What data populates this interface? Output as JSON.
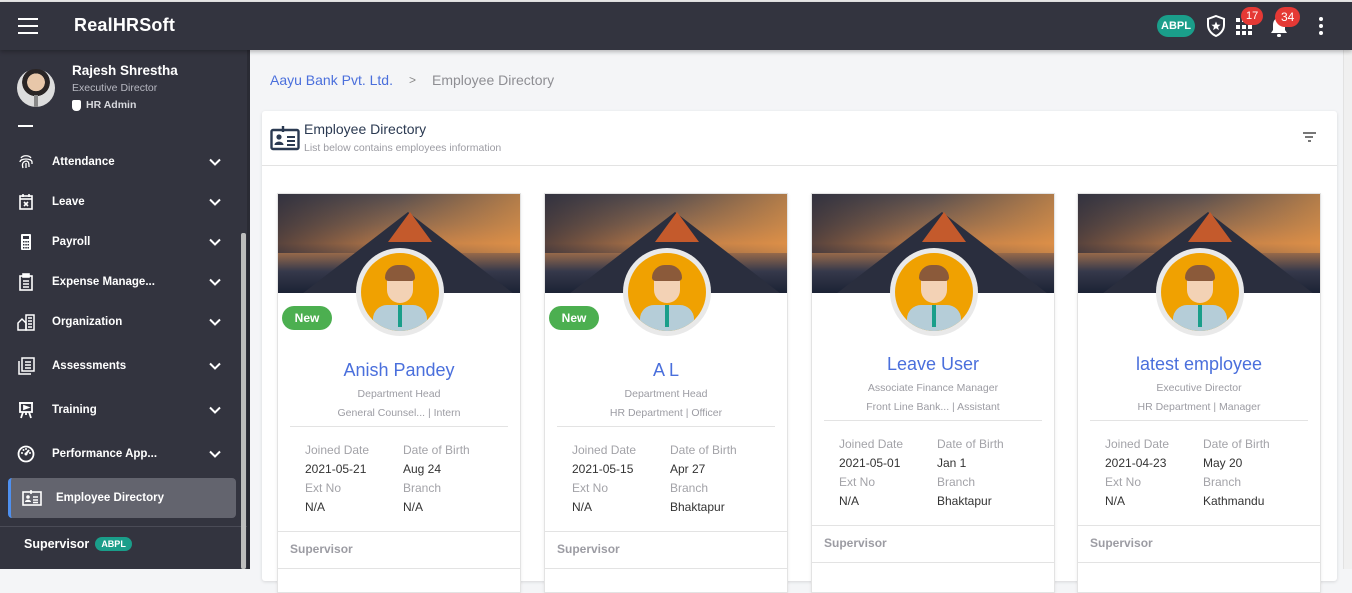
{
  "app": {
    "title": "RealHRSoft"
  },
  "topbar": {
    "company_badge": "ABPL",
    "apps_count": "17",
    "notifications_count": "34"
  },
  "profile": {
    "name": "Rajesh Shrestha",
    "designation": "Executive Director",
    "role": "HR Admin"
  },
  "sidebar": {
    "items": [
      {
        "label": "Attendance",
        "icon": "fingerprint-icon",
        "expandable": true
      },
      {
        "label": "Leave",
        "icon": "calendar-x-icon",
        "expandable": true
      },
      {
        "label": "Payroll",
        "icon": "calculator-icon",
        "expandable": true
      },
      {
        "label": "Expense Manage...",
        "icon": "clipboard-list-icon",
        "expandable": true
      },
      {
        "label": "Organization",
        "icon": "building-icon",
        "expandable": true
      },
      {
        "label": "Assessments",
        "icon": "documents-icon",
        "expandable": true
      },
      {
        "label": "Training",
        "icon": "presentation-icon",
        "expandable": true
      },
      {
        "label": "Performance App...",
        "icon": "speedometer-icon",
        "expandable": true
      },
      {
        "label": "Employee Directory",
        "icon": "id-card-icon",
        "expandable": false,
        "active": true
      }
    ],
    "supervisor_label": "Supervisor",
    "supervisor_badge": "ABPL"
  },
  "breadcrumb": {
    "parent": "Aayu Bank Pvt. Ltd.",
    "separator": ">",
    "current": "Employee Directory"
  },
  "panel": {
    "title": "Employee Directory",
    "subtitle": "List below contains employees information"
  },
  "labels": {
    "joined_date": "Joined Date",
    "date_of_birth": "Date of Birth",
    "ext_no": "Ext No",
    "branch": "Branch",
    "supervisor": "Supervisor",
    "new_badge": "New"
  },
  "employees": [
    {
      "name": "Anish Pandey",
      "designation": "Department Head",
      "department": "General Counsel... | Intern",
      "joined_date": "2021-05-21",
      "date_of_birth": "Aug 24",
      "ext_no": "N/A",
      "branch": "N/A",
      "is_new": true
    },
    {
      "name": "A L",
      "designation": "Department Head",
      "department": "HR Department | Officer",
      "joined_date": "2021-05-15",
      "date_of_birth": "Apr 27",
      "ext_no": "N/A",
      "branch": "Bhaktapur",
      "is_new": true
    },
    {
      "name": "Leave User",
      "designation": "Associate Finance Manager",
      "department": "Front Line Bank... | Assistant",
      "joined_date": "2021-05-01",
      "date_of_birth": "Jan 1",
      "ext_no": "N/A",
      "branch": "Bhaktapur",
      "is_new": false
    },
    {
      "name": "latest employee",
      "designation": "Executive Director",
      "department": "HR Department | Manager",
      "joined_date": "2021-04-23",
      "date_of_birth": "May 20",
      "ext_no": "N/A",
      "branch": "Kathmandu",
      "is_new": false
    }
  ],
  "colors": {
    "topbar_bg": "#33343f",
    "accent_blue": "#4a6fdc",
    "badge_teal": "#1a9e8a",
    "new_green": "#4caf50",
    "notification_red": "#e53935",
    "active_indicator": "#4e90f0"
  }
}
